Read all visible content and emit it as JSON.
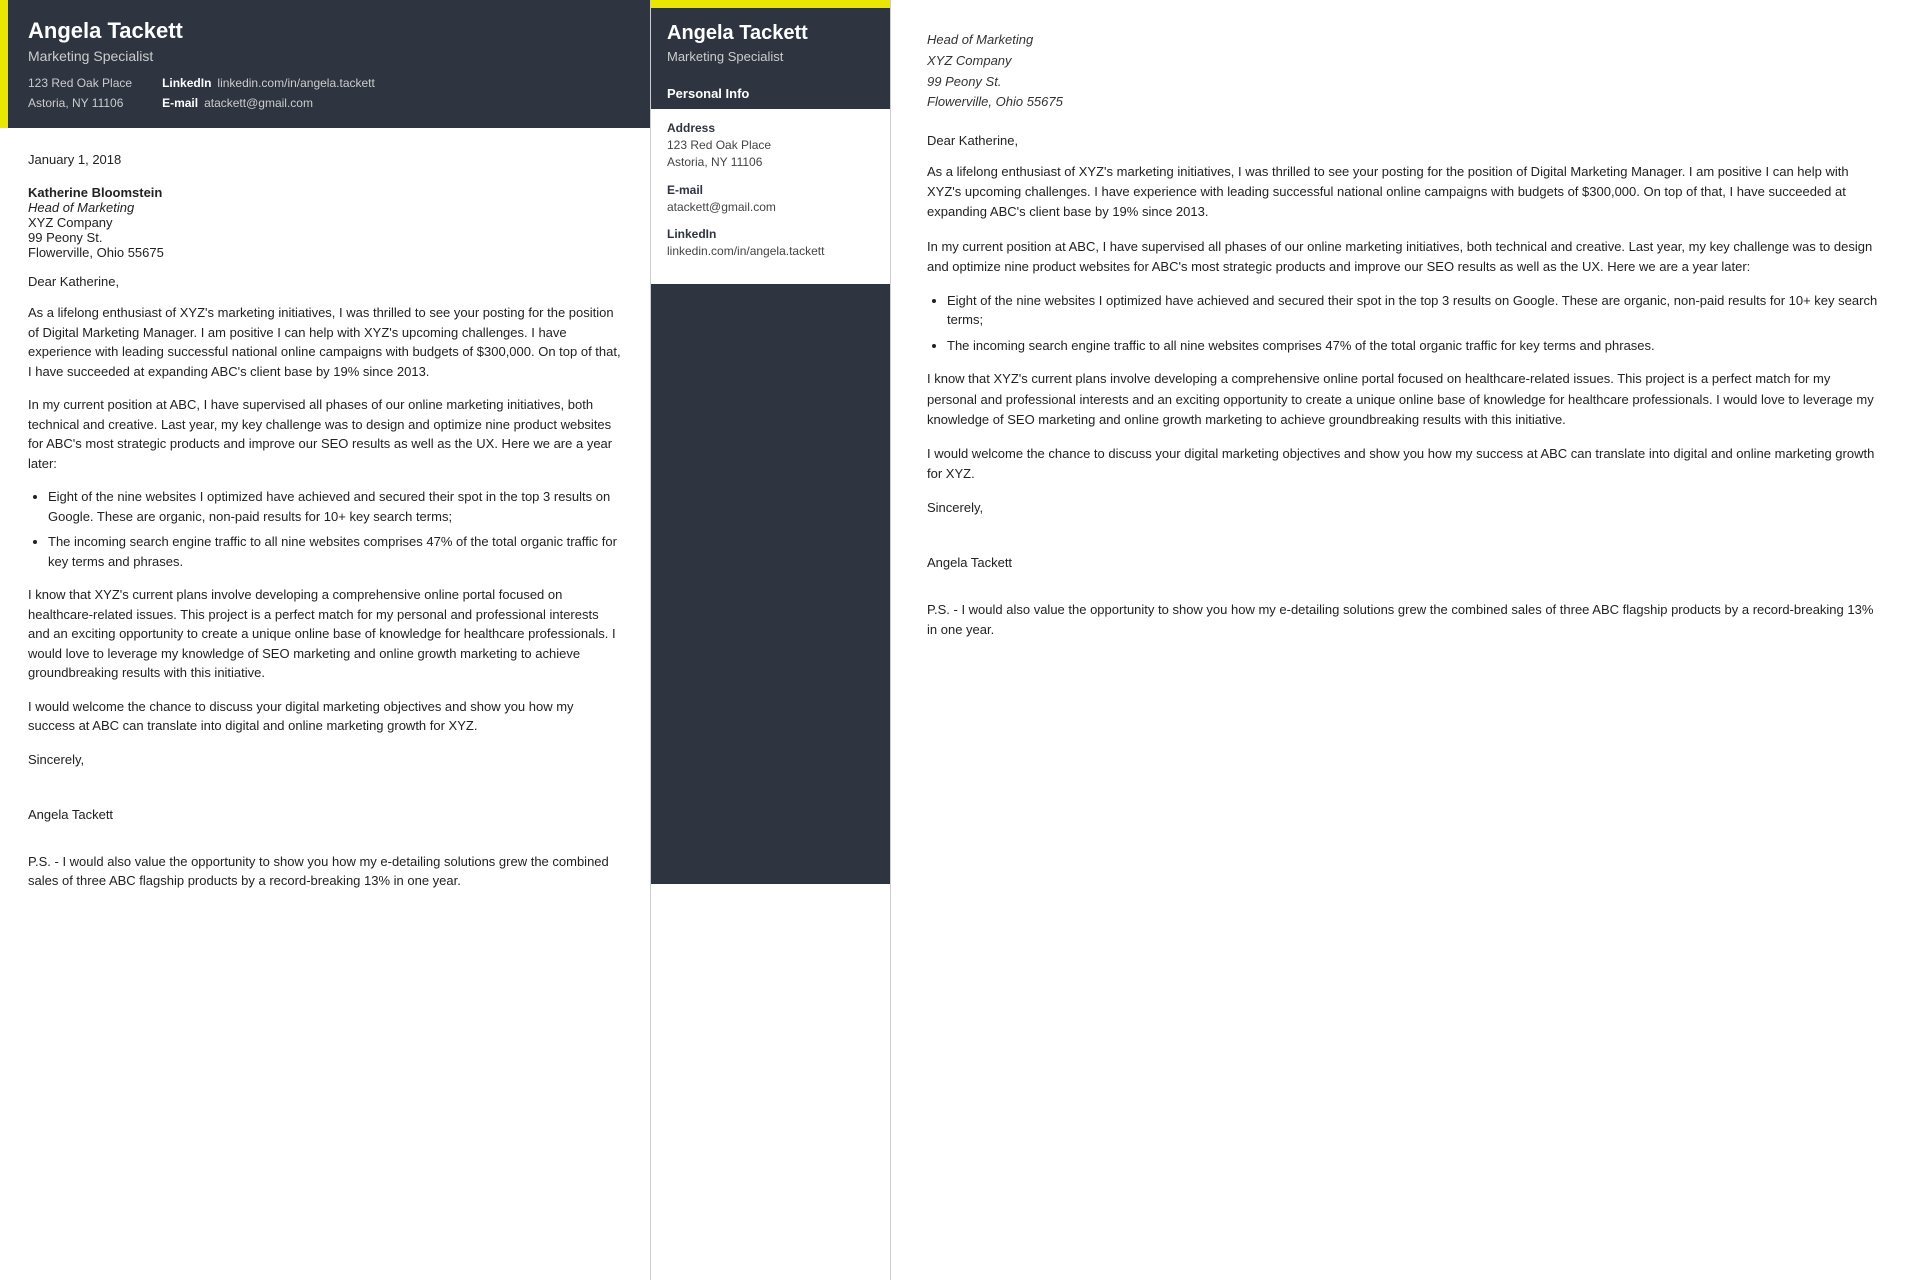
{
  "left": {
    "header": {
      "name": "Angela Tackett",
      "title": "Marketing Specialist",
      "address_line1": "123 Red Oak Place",
      "address_line2": "Astoria, NY 11106",
      "linkedin_label": "LinkedIn",
      "linkedin_value": "linkedin.com/in/angela.tackett",
      "email_label": "E-mail",
      "email_value": "atackett@gmail.com"
    },
    "body": {
      "date": "January 1, 2018",
      "recipient_name": "Katherine Bloomstein",
      "recipient_title": "Head of Marketing",
      "recipient_company": "XYZ Company",
      "recipient_address1": "99 Peony St.",
      "recipient_address2": "Flowerville, Ohio 55675",
      "salutation": "Dear Katherine,",
      "paragraph1": "As a lifelong enthusiast of XYZ's marketing initiatives, I was thrilled to see your posting for the position of Digital Marketing Manager. I am positive I can help with XYZ's upcoming challenges. I have experience with leading successful national online campaigns with budgets of $300,000. On top of that, I have succeeded at expanding ABC's client base by 19% since 2013.",
      "paragraph2": "In my current position at ABC, I have supervised all phases of our online marketing initiatives, both technical and creative. Last year, my key challenge was to design and optimize nine product websites for ABC's most strategic products and improve our SEO results as well as the UX. Here we are a year later:",
      "bullet1": "Eight of the nine websites I optimized have achieved and secured their spot in the top 3 results on Google. These are organic, non-paid results for 10+ key search terms;",
      "bullet2": "The incoming search engine traffic to all nine websites comprises 47% of the total organic traffic for key terms and phrases.",
      "paragraph3": "I know that XYZ's current plans involve developing a comprehensive online portal focused on healthcare-related issues. This project is a perfect match for my personal and professional interests and an exciting opportunity to create a unique online base of knowledge for healthcare professionals. I would love to leverage my knowledge of SEO marketing and online growth marketing to achieve groundbreaking results with this initiative.",
      "paragraph4": "I would welcome the chance to discuss your digital marketing objectives and show you how my success at ABC can translate into digital and online marketing growth for XYZ.",
      "closing": "Sincerely,",
      "signature": "Angela Tackett",
      "ps": "P.S. - I would also value the opportunity to show you how my e-detailing solutions grew the combined sales of three ABC flagship products by a record-breaking 13% in one year."
    }
  },
  "middle": {
    "header": {
      "name": "Angela Tackett",
      "title": "Marketing Specialist"
    },
    "personal_info_section": "Personal Info",
    "address_label": "Address",
    "address_line1": "123 Red Oak Place",
    "address_line2": "Astoria, NY 11106",
    "email_label": "E-mail",
    "email_value": "atackett@gmail.com",
    "linkedin_label": "LinkedIn",
    "linkedin_value": "linkedin.com/in/angela.tackett"
  },
  "right": {
    "sender_title": "Head of Marketing",
    "sender_company": "XYZ Company",
    "sender_address1": "99 Peony St.",
    "sender_address2": "Flowerville, Ohio 55675",
    "salutation": "Dear Katherine,",
    "paragraph1": "As a lifelong enthusiast of XYZ's marketing initiatives, I was thrilled to see your posting for the position of Digital Marketing Manager. I am positive I can help with XYZ's upcoming challenges. I have experience with leading successful national online campaigns with budgets of $300,000. On top of that, I have succeeded at expanding ABC's client base by 19% since 2013.",
    "paragraph2": "In my current position at ABC, I have supervised all phases of our online marketing initiatives, both technical and creative. Last year, my key challenge was to design and optimize nine product websites for ABC's most strategic products and improve our SEO results as well as the UX. Here we are a year later:",
    "bullet1": "Eight of the nine websites I optimized have achieved and secured their spot in the top 3 results on Google. These are organic, non-paid results for 10+ key search terms;",
    "bullet2": "The incoming search engine traffic to all nine websites comprises 47% of the total organic traffic for key terms and phrases.",
    "paragraph3": "I know that XYZ's current plans involve developing a comprehensive online portal focused on healthcare-related issues. This project is a perfect match for my personal and professional interests and an exciting opportunity to create a unique online base of knowledge for healthcare professionals. I would love to leverage my knowledge of SEO marketing and online growth marketing to achieve groundbreaking results with this initiative.",
    "paragraph4": "I would welcome the chance to discuss your digital marketing objectives and show you how my success at ABC can translate into digital and online marketing growth for XYZ.",
    "closing": "Sincerely,",
    "signature": "Angela Tackett",
    "ps": "P.S. - I would also value the opportunity to show you how my e-detailing solutions grew the combined sales of three ABC flagship products by a record-breaking 13% in one year."
  }
}
